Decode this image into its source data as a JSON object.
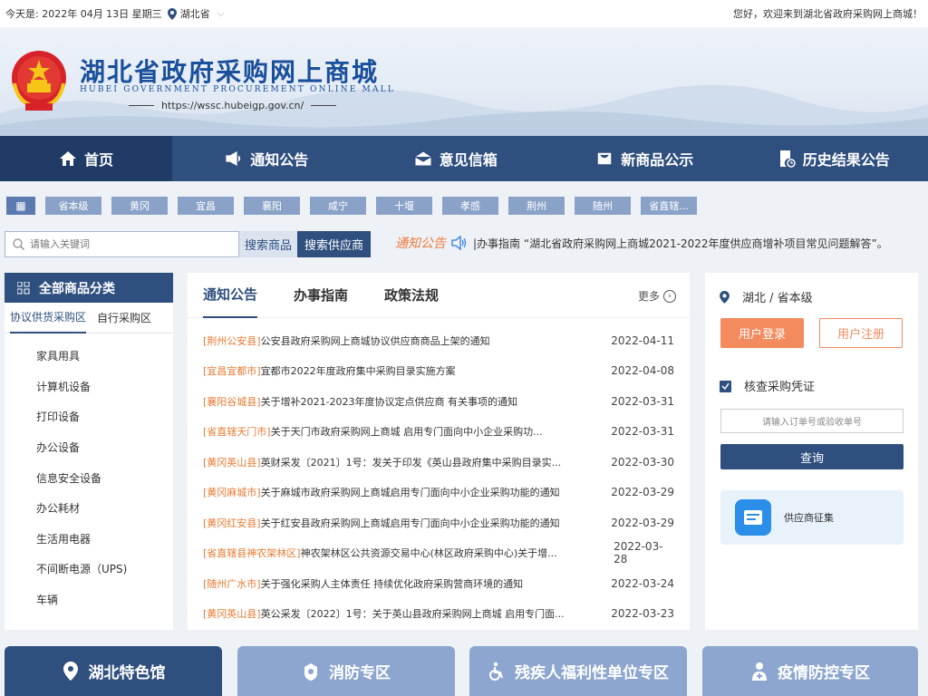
{
  "topbar": {
    "date": "今天是: 2022年 04月 13日 星期三",
    "location": "湖北省",
    "welcome": "您好，欢迎来到湖北省政府采购网上商城！"
  },
  "header": {
    "title": "湖北省政府采购网上商城",
    "subtitle": "HUBEI GOVERNMENT PROCUREMENT ONLINE MALL",
    "url": "https://wssc.hubeigp.gov.cn/"
  },
  "nav": [
    {
      "label": "首页",
      "icon": "home-icon"
    },
    {
      "label": "通知公告",
      "icon": "megaphone-icon"
    },
    {
      "label": "意见信箱",
      "icon": "mail-icon"
    },
    {
      "label": "新商品公示",
      "icon": "cart-icon"
    },
    {
      "label": "历史结果公告",
      "icon": "history-doc-icon"
    }
  ],
  "regions": [
    "省本级",
    "黄冈",
    "宜昌",
    "襄阳",
    "咸宁",
    "十堰",
    "孝感",
    "荆州",
    "随州",
    "省直辖..."
  ],
  "search": {
    "placeholder": "请输入关键词",
    "btn_goods": "搜索商品",
    "btn_supplier": "搜索供应商"
  },
  "notice_strip": {
    "tag": "通知公告",
    "text": "|办事指南 “湖北省政府采购网上商城2021-2022年度供应商增补项目常见问题解答”。"
  },
  "category": {
    "title": "全部商品分类",
    "tabs": [
      "协议供货采购区",
      "自行采购区"
    ],
    "items": [
      "家具用具",
      "计算机设备",
      "打印设备",
      "办公设备",
      "信息安全设备",
      "办公耗材",
      "生活用电器",
      "不间断电源（UPS)",
      "车辆"
    ]
  },
  "news": {
    "tabs": [
      "通知公告",
      "办事指南",
      "政策法规"
    ],
    "more": "更多",
    "rows": [
      {
        "src": "[荆州公安县]",
        "title": "公安县政府采购网上商城协议供应商商品上架的通知",
        "date": "2022-04-11"
      },
      {
        "src": "[宜昌宜都市]",
        "title": "宜都市2022年度政府集中采购目录实施方案",
        "date": "2022-04-08"
      },
      {
        "src": "[襄阳谷城县]",
        "title": "关于增补2021-2023年度协议定点供应商 有关事项的通知",
        "date": "2022-03-31"
      },
      {
        "src": "[省直辖天门市]",
        "title": "关于天门市政府采购网上商城 启用专门面向中小企业采购功...",
        "date": "2022-03-31"
      },
      {
        "src": "[黄冈英山县]",
        "title": "英财采发〔2021〕1号：发关于印发《英山县政府集中采购目录实...",
        "date": "2022-03-30"
      },
      {
        "src": "[黄冈麻城市]",
        "title": "关于麻城市政府采购网上商城启用专门面向中小企业采购功能的通知",
        "date": "2022-03-29"
      },
      {
        "src": "[黄冈红安县]",
        "title": "关于红安县政府采购网上商城启用专门面向中小企业采购功能的通知",
        "date": "2022-03-29"
      },
      {
        "src": "[省直辖县神农架林区]",
        "title": "神农架林区公共资源交易中心(林区政府采购中心)关于增...",
        "date": "2022-03-28"
      },
      {
        "src": "[随州广水市]",
        "title": "关于强化采购人主体责任 持续优化政府采购营商环境的通知",
        "date": "2022-03-24"
      },
      {
        "src": "[黄冈英山县]",
        "title": "英公采发〔2022〕1号：关于英山县政府采购网上商城 启用专门面...",
        "date": "2022-03-23"
      }
    ]
  },
  "side": {
    "region": "湖北 / 省本级",
    "login": "用户登录",
    "register": "用户注册",
    "verify_title": "核查采购凭证",
    "verify_placeholder": "请输入订单号或验收单号",
    "query": "查询",
    "supplier": "供应商征集"
  },
  "tiles": [
    "湖北特色馆",
    "消防专区",
    "残疾人福利性单位专区",
    "疫情防控专区"
  ]
}
